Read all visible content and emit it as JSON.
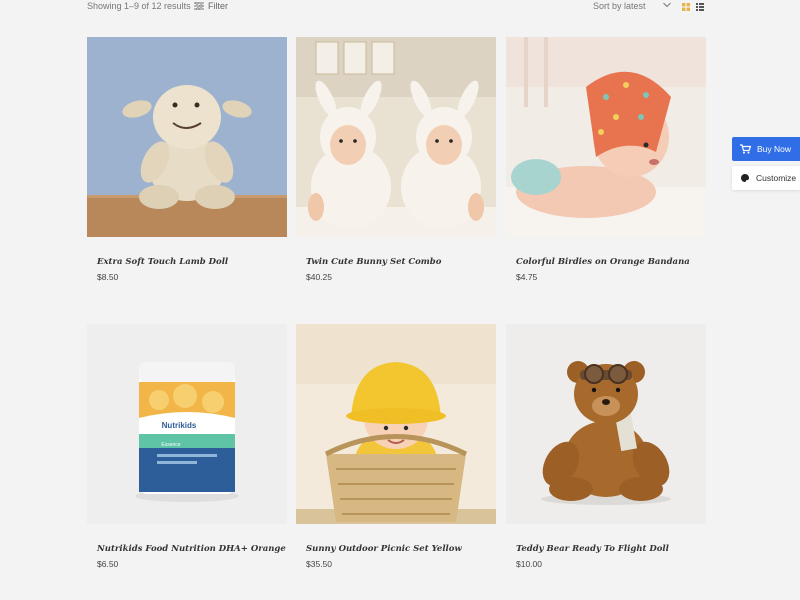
{
  "toolbar": {
    "results_text": "Showing 1–9 of 12 results",
    "filter_label": "Filter",
    "sort_label": "Sort by latest"
  },
  "side_buttons": {
    "buy_now": "Buy Now",
    "customize": "Customize"
  },
  "products": [
    {
      "name": "Extra Soft Touch Lamb Doll",
      "price": "$8.50"
    },
    {
      "name": "Twin Cute Bunny Set Combo",
      "price": "$40.25"
    },
    {
      "name": "Colorful Birdies on Orange Bandana",
      "price": "$4.75"
    },
    {
      "name": "Nutrikids Food Nutrition DHA+ Orange",
      "price": "$6.50"
    },
    {
      "name": "Sunny Outdoor Picnic Set Yellow",
      "price": "$35.50"
    },
    {
      "name": "Teddy Bear Ready To Flight Doll",
      "price": "$10.00"
    }
  ],
  "product_images": {
    "nutrikids_brand": "Nutrikids",
    "nutrikids_variant": "Essence"
  },
  "colors": {
    "accent": "#2f6ee6",
    "grid_view_active": "#e8b44a",
    "background": "#f3f3f4"
  }
}
